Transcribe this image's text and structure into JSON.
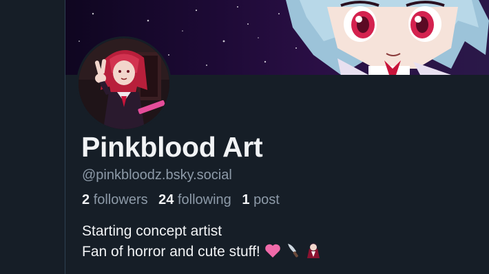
{
  "profile": {
    "display_name": "Pinkblood Art",
    "handle": "@pinkbloodz.bsky.social",
    "followers_count": "2",
    "followers_label": "followers",
    "following_count": "24",
    "following_label": "following",
    "posts_count": "1",
    "posts_label": "post",
    "bio_line1": "Starting concept artist",
    "bio_line2": "Fan of horror and cute stuff!"
  },
  "bio_icons": [
    "pink-heart-icon",
    "knife-icon",
    "vampire-icon"
  ],
  "colors": {
    "background": "#161e27",
    "text_primary": "#f1f3f5",
    "text_secondary": "#8d9aa8",
    "divider": "#2e4052"
  }
}
